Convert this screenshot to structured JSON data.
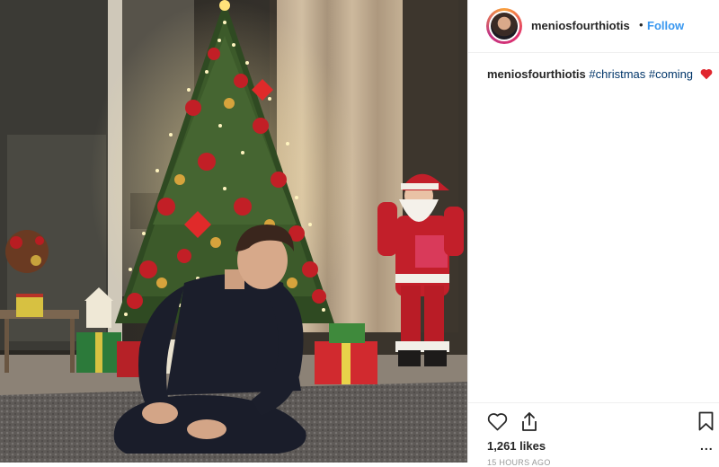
{
  "post": {
    "username": "meniosfourthiotis",
    "follow_label": "Follow",
    "separator": "•",
    "caption": {
      "username": "meniosfourthiotis",
      "hashtags": [
        "#christmas",
        "#coming"
      ],
      "emoji": "red-heart-emoji"
    },
    "likes_text": "1,261 likes",
    "time_text": "15 HOURS AGO",
    "more_label": "..."
  },
  "icons": {
    "like": "heart-outline-icon",
    "share": "share-upload-icon",
    "save": "bookmark-icon"
  },
  "colors": {
    "link_blue": "#3897f0",
    "hashtag": "#003569",
    "text": "#262626",
    "heart_red": "#ed4956"
  }
}
